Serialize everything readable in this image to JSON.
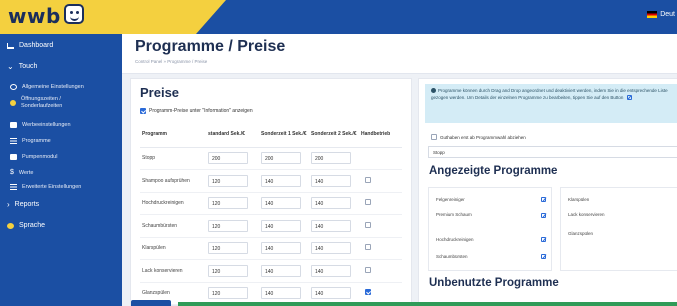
{
  "brand": {
    "logo_text": "wwb",
    "logo_sub": "..."
  },
  "header": {
    "lang_label": "Deut"
  },
  "sidebar": {
    "items": [
      {
        "label": "Dashboard"
      },
      {
        "label": "Touch"
      },
      {
        "label": "Allgemeine Einstellungen"
      },
      {
        "label": "Öffnungszeiten / Sonderlaufzeiten"
      },
      {
        "label": "Werbeeinstellungen"
      },
      {
        "label": "Programme"
      },
      {
        "label": "Pumpenmodul"
      },
      {
        "label": "Werte"
      },
      {
        "label": "Erweiterte Einstellungen"
      },
      {
        "label": "Reports"
      },
      {
        "label": "Sprache"
      }
    ]
  },
  "page": {
    "title": "Programme / Preise",
    "breadcrumb": "Control Panel » Programme / Preise"
  },
  "prices": {
    "title": "Preise",
    "show_in_info_label": "Programm-Preise unter \"Information\" anzeigen",
    "show_in_info_checked": true,
    "columns": [
      "Programm",
      "standard Sek./€",
      "Sonderzeit 1 Sek./€",
      "Sonderzeit 2 Sek./€",
      "Handbetrieb"
    ],
    "rows": [
      {
        "name": "Stopp",
        "std": "200",
        "s1": "200",
        "s2": "200",
        "hand": null
      },
      {
        "name": "Shampoo aufsprühen",
        "std": "120",
        "s1": "140",
        "s2": "140",
        "hand": false
      },
      {
        "name": "Hochdruckreinigen",
        "std": "120",
        "s1": "140",
        "s2": "140",
        "hand": false
      },
      {
        "name": "Schaumbürsten",
        "std": "120",
        "s1": "140",
        "s2": "140",
        "hand": false
      },
      {
        "name": "Klarspülen",
        "std": "120",
        "s1": "140",
        "s2": "140",
        "hand": false
      },
      {
        "name": "Lack konservieren",
        "std": "120",
        "s1": "140",
        "s2": "140",
        "hand": false
      },
      {
        "name": "Glanzspülen",
        "std": "120",
        "s1": "140",
        "s2": "140",
        "hand": true
      }
    ]
  },
  "programs": {
    "info_text": "Programme können durch Drag and Drop angeordnet und deaktiviert werden, indem Sie in die entsprechende Liste gezogen werden. Um Details der einzelnen Programme zu bearbeiten, tippen Sie auf den Button",
    "guthaben_label": "Guthaben erst ab Programmwahl abziehen",
    "guthaben_checked": false,
    "stopp_value": "Stopp",
    "shown_title": "Angezeigte Programme",
    "unused_title": "Unbenutzte Programme",
    "shown_left": [
      "Felgenreiniger",
      "Premium Schaum",
      "Hochdruckreinigen",
      "Schaumbürsten"
    ],
    "shown_right": [
      "Klarspülen",
      "Lack konservieren",
      "Glanzspülen"
    ]
  },
  "colors": {
    "primary": "#1b4fa3",
    "accent": "#f4d03f",
    "success": "#2f9b58",
    "info_bg": "#d4ecf6"
  }
}
